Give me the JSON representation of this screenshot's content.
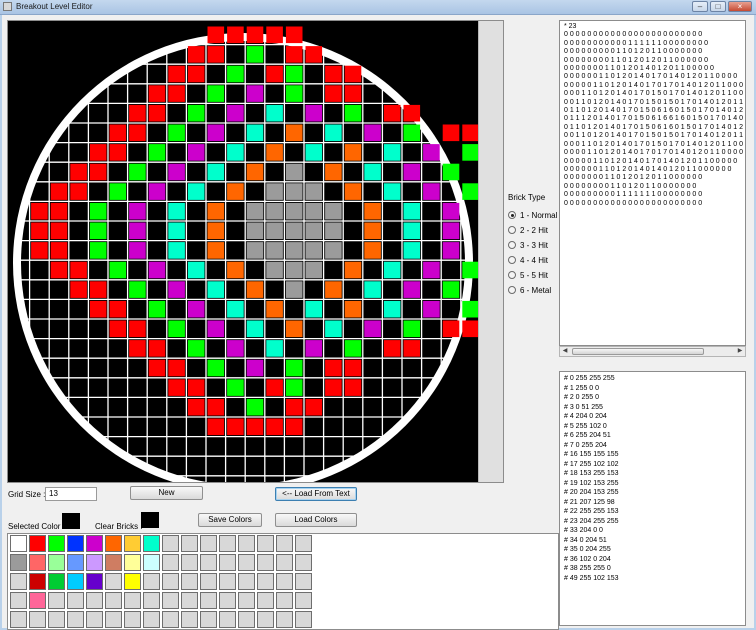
{
  "window": {
    "title": "Breakout Level Editor",
    "min_icon": "minimize-icon",
    "max_icon": "maximize-icon",
    "close_icon": "close-icon"
  },
  "editor": {
    "grid_size_label": "Grid Size :",
    "grid_size_value": "13",
    "new_label": "New",
    "load_from_text_label": "<-- Load From Text",
    "save_colors_label": "Save Colors",
    "load_colors_label": "Load Colors",
    "selected_color_label": "Selected Color :",
    "clear_bricks_label": "Clear Bricks :",
    "selected_color": "#000000",
    "clear_bricks_color": "#000000"
  },
  "brick_type": {
    "title": "Brick Type",
    "options": [
      {
        "label": "1 - Normal",
        "checked": true
      },
      {
        "label": "2 - 2 Hit",
        "checked": false
      },
      {
        "label": "3 - 3 Hit",
        "checked": false
      },
      {
        "label": "4 - 4 Hit",
        "checked": false
      },
      {
        "label": "5 - 5 Hit",
        "checked": false
      },
      {
        "label": "6 - Metal",
        "checked": false
      }
    ]
  },
  "level_text": "* 23\n0 0 0 0 0 0 0 0 0 0 0 0 0 0 0 0 0 0 0 0 0 0 0 0\n0 0 0 0 0 0 0 0 0 0 0 1 1 1 1 1 1 0 0 0 0 0 0 0 0\n0 0 0 0 0 0 0 0 0 1 1 0 1 2 0 1 1 0 0 0 0 0 0 0\n0 0 0 0 0 0 0 0 1 1 0 1 2 0 1 2 0 1 1 0 0 0 0 0 0\n0 0 0 0 0 0 0 1 1 0 1 2 0 1 4 0 1 2 0 1 1 0 0 0 0 0\n0 0 0 0 0 0 1 1 0 1 2 0 1 4 0 1 7 0 1 4 0 1 2 0 1 1 0 0 0 0\n0 0 0 0 0 1 1 0 1 2 0 1 4 0 1 7 0 1 7 0 1 4 0 1 2 0 1 1 0 0 0 0\n0 0 0 1 1 0 1 2 0 1 4 0 1 7 0 1 5 0 1 7 0 1 4 0 1 2 0 1 1 0 0 0\n0 0 1 1 0 1 2 0 1 4 0 1 7 0 1 5 0 1 5 0 1 7 0 1 4 0 1 2 0 1 1 0 0\n0 1 1 0 1 2 0 1 4 0 1 7 0 1 5 0 6 1 6 0 1 5 0 1 7 0 1 4 0 1 2 0 1 1 0\n0 1 1 1 2 0 1 4 0 1 7 0 1 5 0 6 1 6 6 1 6 0 1 5 0 1 7 0 1 4 0\n0 1 1 0 1 2 0 1 4 0 1 7 0 1 5 0 6 1 6 0 1 5 0 1 7 0 1 4 0 1 2 0 1 1 0\n0 0 1 1 0 1 2 0 1 4 0 1 7 0 1 5 0 1 5 0 1 7 0 1 4 0 1 2 0 1 1 0 0\n0 0 0 1 1 0 1 2 0 1 4 0 1 7 0 1 5 0 1 7 0 1 4 0 1 2 0 1 1 0 0 0\n0 0 0 0 1 1 0 1 2 0 1 4 0 1 7 0 1 7 0 1 4 0 1 2 0 1 1 0 0 0 0\n0 0 0 0 0 1 1 0 1 2 0 1 4 0 1 7 0 1 4 0 1 2 0 1 1 0 0 0 0 0\n0 0 0 0 0 0 1 1 0 1 2 0 1 4 0 1 4 0 1 2 0 1 1 0 0 0 0 0 0\n0 0 0 0 0 0 0 1 1 0 1 2 0 1 2 0 1 1 0 0 0 0 0 0\n0 0 0 0 0 0 0 0 1 1 0 1 2 0 1 1 0 0 0 0 0 0 0\n0 0 0 0 0 0 0 0 0 1 1 1 1 1 1 1 0 0 0 0 0 0 0 0\n0 0 0 0 0 0 0 0 0 0 0 0 0 0 0 0 0 0 0 0 0 0 0 0",
  "color_text": "# 0 255 255 255\n# 1 255 0 0\n# 2 0 255 0\n# 3 0 51 255\n# 4 204 0 204\n# 5 255 102 0\n# 6 255 204 51\n# 7 0 255 204\n# 16 155 155 155\n# 17 255 102 102\n# 18 153 255 153\n# 19 102 153 255\n# 20 204 153 255\n# 21 207 125 98\n# 22 255 255 153\n# 23 204 255 255\n# 33 204 0 0\n# 34 0 204 51\n# 35 0 204 255\n# 36 102 0 204\n# 38 255 255 0\n# 49 255 102 153",
  "palette": {
    "rows": [
      [
        "#ffffff",
        "#ff0000",
        "#00ff00",
        "#0033ff",
        "#cc00cc",
        "#ff6600",
        "#ffcc33",
        "#00ffcc"
      ],
      [
        "#9b9b9b",
        "#ff6666",
        "#99ff99",
        "#6699ff",
        "#cc99ff",
        "#cf7d62",
        "#ffff99",
        "#ccffff"
      ],
      [
        "",
        "#cc0000",
        "#00cc33",
        "#00ccff",
        "#6600cc",
        "",
        "#ffff00",
        ""
      ],
      [
        "",
        "#ff6699",
        "",
        "",
        "",
        "",
        "",
        ""
      ]
    ],
    "empty_color": "#d8d8d8"
  },
  "level_grid": {
    "size": 23,
    "cells": [
      "00000000011111000000000",
      "00000000110201100000000",
      "00000001102012011000000",
      "00000011020402011000000",
      "00000110204070402011000",
      "00001102040705070402011",
      "00011020407050705070402",
      "00110204070506050704020",
      "01102040705066605070402",
      "11020407050666660507040",
      "11020407050666660507040",
      "11020407050666660507040",
      "01102040705066605070402",
      "00110204070506050704020",
      "00011020407050705070402",
      "00001102040705070402011",
      "00000110204070402011000",
      "00000011020402011000000",
      "00000001102012011000000",
      "00000000110201100000000",
      "00000000011111000000000",
      "00000000000000000000000",
      "00000000000000000000000"
    ],
    "colors": {
      "0": "#000000",
      "1": "#ff0000",
      "2": "#00ff00",
      "4": "#cc00cc",
      "5": "#ff6600",
      "6": "#9b9b9b",
      "7": "#00ffcc"
    },
    "grid_line_color": "#ffffff",
    "background": "#000000"
  }
}
